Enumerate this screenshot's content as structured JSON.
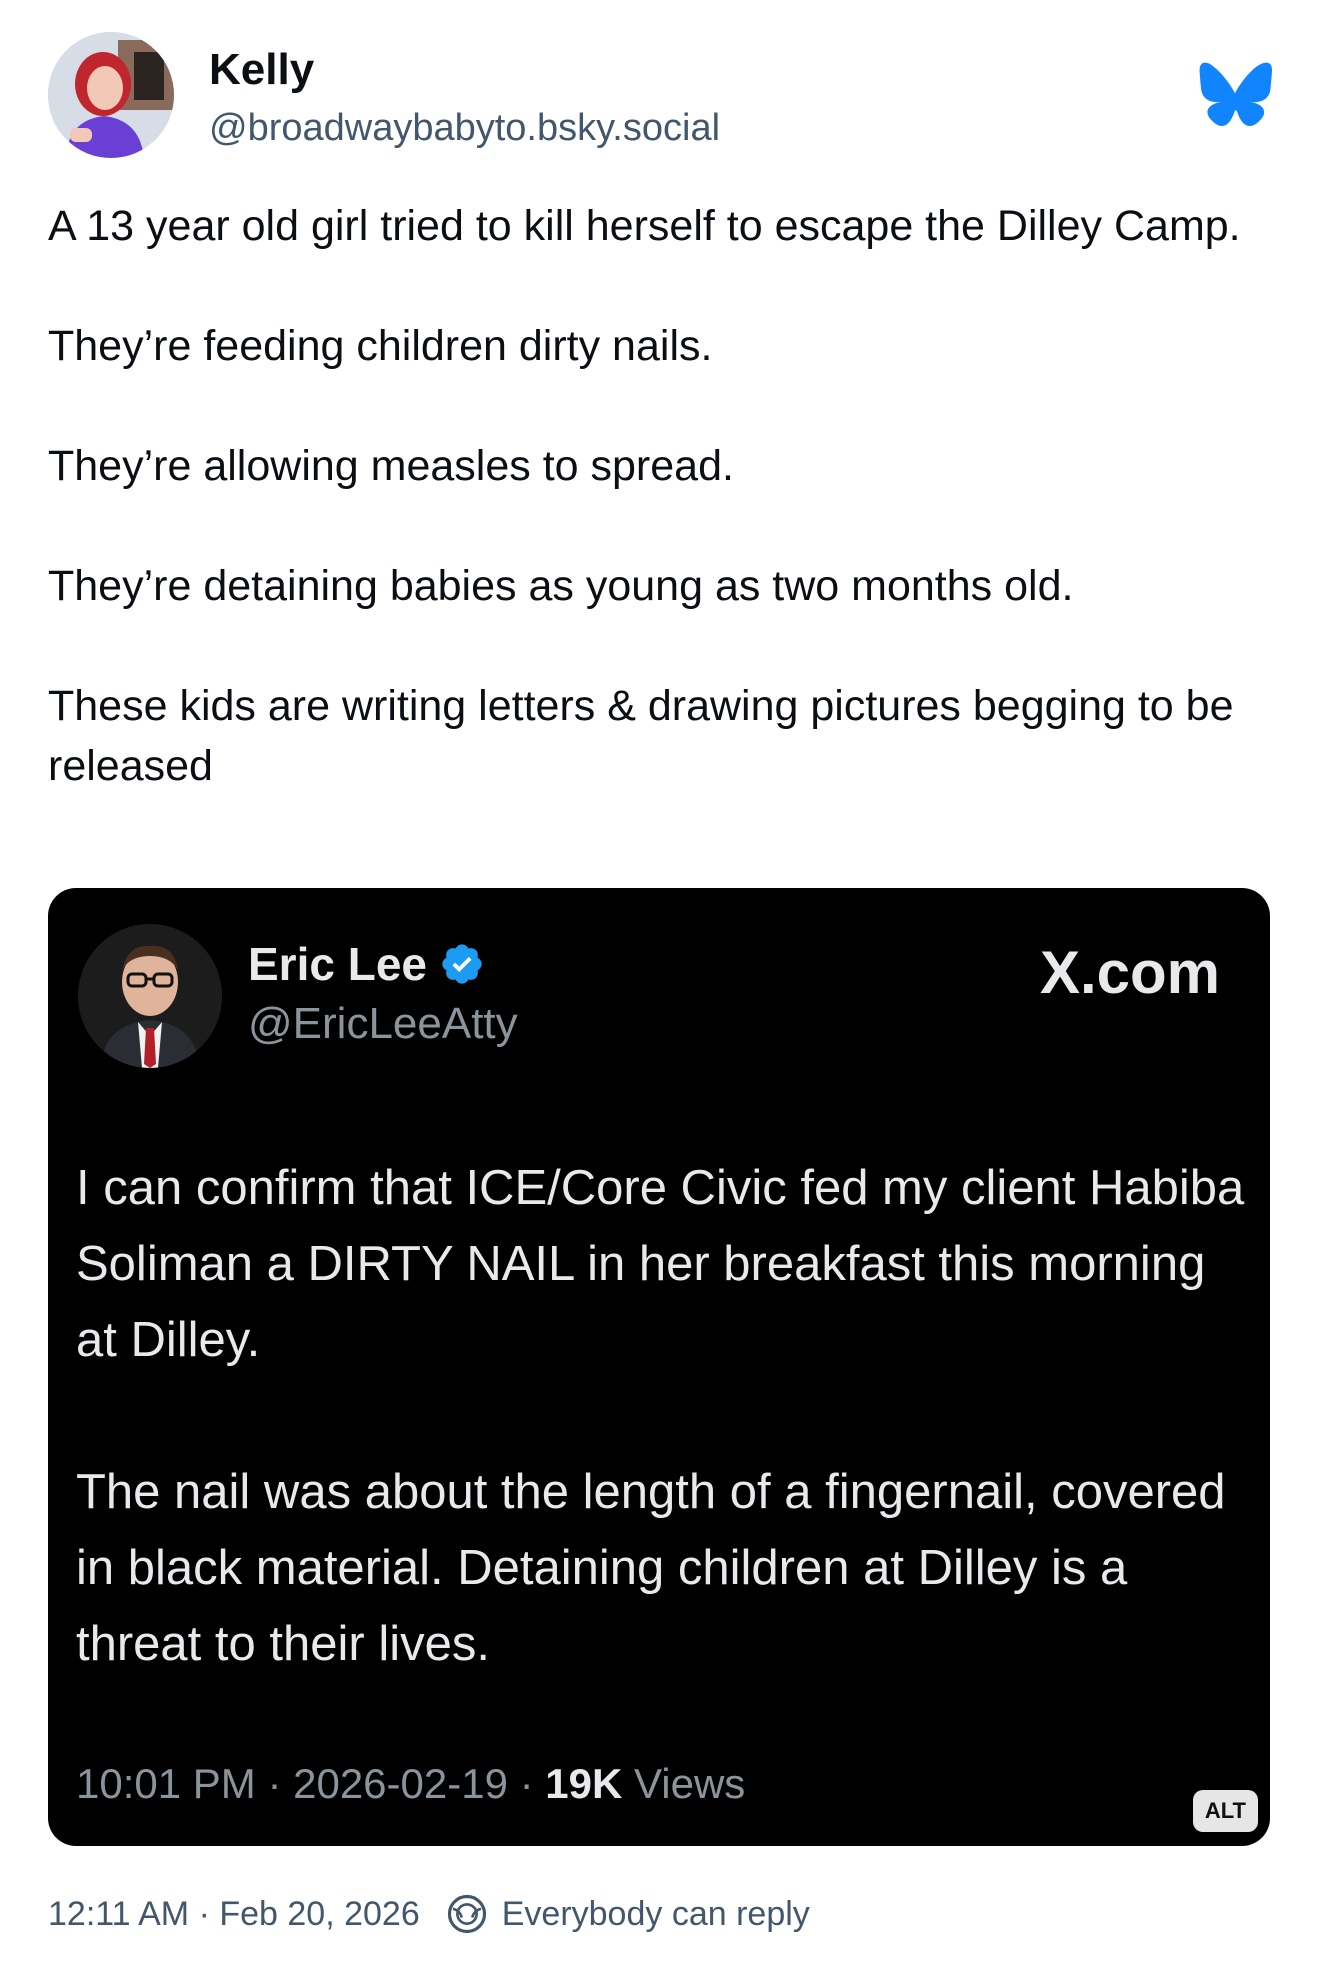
{
  "author": {
    "display_name": "Kelly",
    "handle": "@broadwaybabyto.bsky.social",
    "avatar_icon": "user-avatar",
    "app_logo_icon": "bluesky-butterfly-icon"
  },
  "post": {
    "paragraphs": [
      "A 13 year old girl tried to kill herself to escape the Dilley Camp.",
      "They’re feeding children dirty nails.",
      "They’re allowing measles to spread.",
      "They’re detaining babies as young as two months old.",
      "These kids are writing letters & drawing pictures begging to be released"
    ]
  },
  "embed": {
    "display_name": "Eric Lee",
    "handle": "@EricLeeAtty",
    "source": "X.com",
    "verified_icon": "verified-badge-icon",
    "paragraphs": [
      "I can confirm that ICE/Core Civic fed my client Habiba Soliman a DIRTY NAIL in her breakfast this morning at Dilley.",
      "The nail was about the length of a fingernail, covered in black material. Detaining children at Dilley is a threat to their lives."
    ],
    "time": "10:01 PM",
    "date": "2026-02-19",
    "views_count": "19K",
    "views_label": "Views",
    "alt_label": "ALT"
  },
  "footer": {
    "timestamp": "12:11 AM · Feb 20, 2026",
    "reply_setting": "Everybody can reply"
  },
  "colors": {
    "bluesky_blue": "#1185fe",
    "verified_blue": "#1d9bf0",
    "muted_text": "#42576c",
    "card_background": "#000000"
  }
}
